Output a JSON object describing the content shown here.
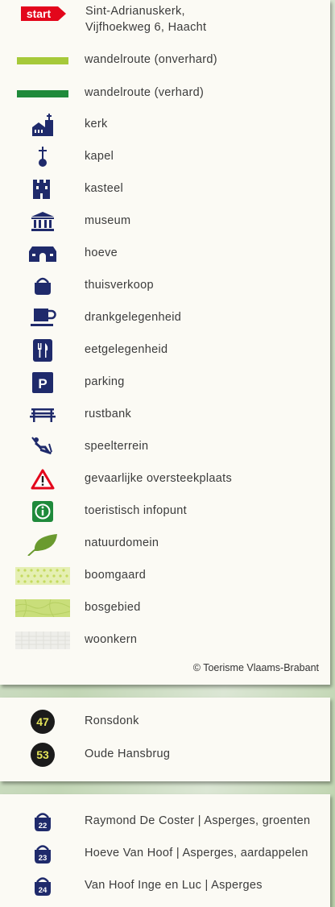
{
  "start": {
    "badge": "start",
    "line1": "Sint-Adrianuskerk,",
    "line2": "Vijfhoekweg 6, Haacht"
  },
  "legend": [
    {
      "icon": "unpaved-route-bar",
      "label": "wandelroute (onverhard)",
      "color": "#a6c93a"
    },
    {
      "icon": "paved-route-bar",
      "label": "wandelroute (verhard)",
      "color": "#1f8a3b"
    },
    {
      "icon": "church-icon",
      "label": "kerk"
    },
    {
      "icon": "chapel-icon",
      "label": "kapel"
    },
    {
      "icon": "castle-icon",
      "label": "kasteel"
    },
    {
      "icon": "museum-icon",
      "label": "museum"
    },
    {
      "icon": "farm-icon",
      "label": "hoeve"
    },
    {
      "icon": "basket-icon",
      "label": "thuisverkoop"
    },
    {
      "icon": "cup-icon",
      "label": "drankgelegenheid"
    },
    {
      "icon": "fork-knife-icon",
      "label": "eetgelegenheid"
    },
    {
      "icon": "parking-icon",
      "label": "parking"
    },
    {
      "icon": "bench-icon",
      "label": "rustbank"
    },
    {
      "icon": "swing-icon",
      "label": "speelterrein"
    },
    {
      "icon": "warning-icon",
      "label": "gevaarlijke oversteekplaats"
    },
    {
      "icon": "info-icon",
      "label": "toeristisch infopunt"
    },
    {
      "icon": "leaf-icon",
      "label": "natuurdomein"
    },
    {
      "icon": "orchard-swatch",
      "label": "boomgaard"
    },
    {
      "icon": "forest-swatch",
      "label": "bosgebied"
    },
    {
      "icon": "residential-swatch",
      "label": "woonkern"
    }
  ],
  "copyright": "© Toerisme Vlaams-Brabant",
  "nodes": [
    {
      "number": "47",
      "label": "Ronsdonk"
    },
    {
      "number": "53",
      "label": "Oude Hansbrug"
    }
  ],
  "sellers": [
    {
      "number": "22",
      "label": "Raymond De Coster | Asperges, groenten"
    },
    {
      "number": "23",
      "label": "Hoeve Van Hoof | Asperges, aardappelen"
    },
    {
      "number": "24",
      "label": "Van Hoof Inge en Luc | Asperges"
    }
  ],
  "colors": {
    "icon_navy": "#1f2a6b",
    "start_red": "#e3061b",
    "node_fill": "#1b1b1b",
    "node_text": "#e4e45a"
  }
}
